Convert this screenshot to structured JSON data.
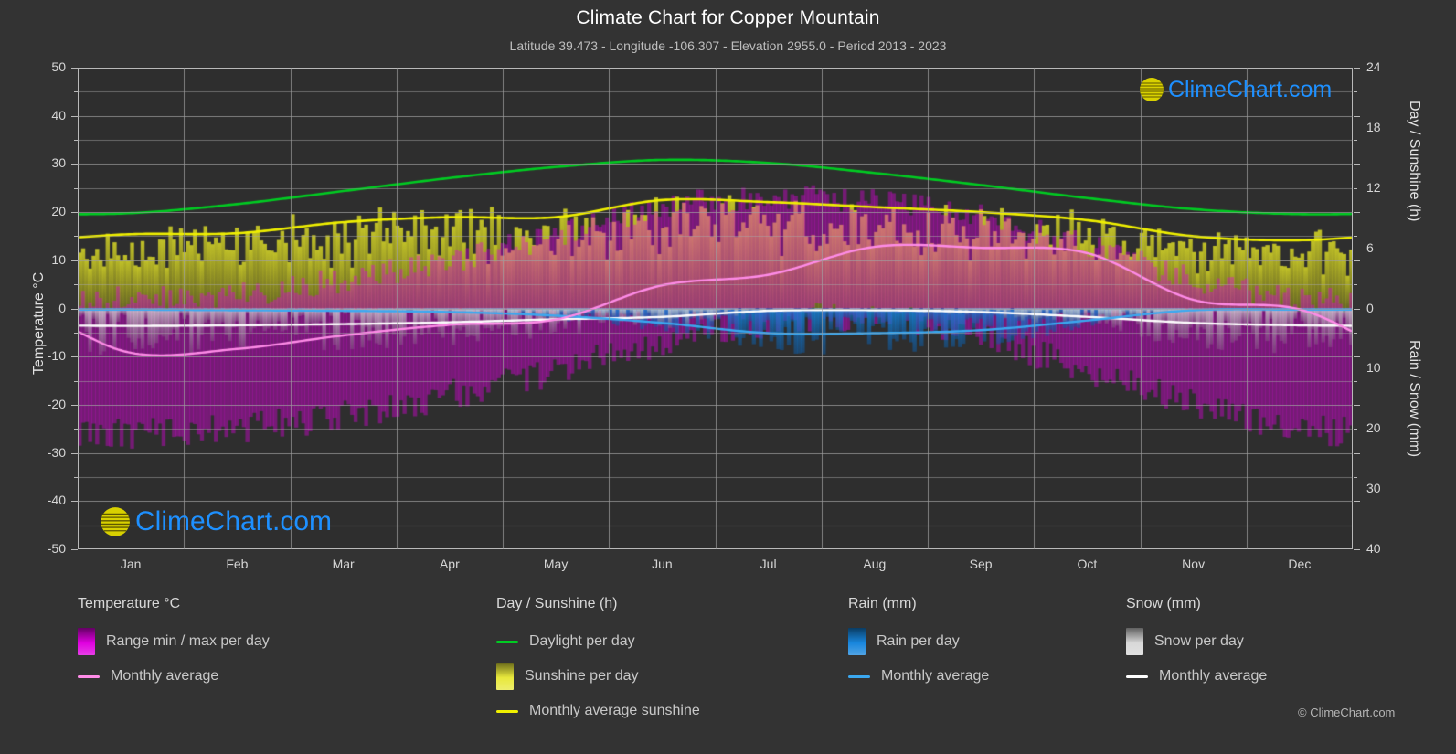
{
  "header": {
    "title": "Climate Chart for Copper Mountain",
    "subtitle": "Latitude 39.473 - Longitude -106.307 - Elevation 2955.0 - Period 2013 - 2023"
  },
  "branding": {
    "logo_text": "ClimeChart.com",
    "copyright": "© ClimeChart.com",
    "logo_crescent_color": "#cc33cc",
    "logo_sphere_color": "#d8d000",
    "logo_text_color": "#1e90ff"
  },
  "axes": {
    "left": {
      "label": "Temperature °C",
      "ticks": [
        "50",
        "40",
        "30",
        "20",
        "10",
        "0",
        "-10",
        "-20",
        "-30",
        "-40",
        "-50"
      ],
      "min": -50,
      "max": 50,
      "step": 10
    },
    "right_top": {
      "label": "Day / Sunshine (h)",
      "ticks": [
        "24",
        "18",
        "12",
        "6",
        "0"
      ],
      "min": 0,
      "max": 24
    },
    "right_bottom": {
      "label": "Rain / Snow (mm)",
      "ticks": [
        "0",
        "10",
        "20",
        "30",
        "40"
      ],
      "min": 0,
      "max": 40
    },
    "x": {
      "label": "",
      "ticks": [
        "Jan",
        "Feb",
        "Mar",
        "Apr",
        "May",
        "Jun",
        "Jul",
        "Aug",
        "Sep",
        "Oct",
        "Nov",
        "Dec"
      ]
    }
  },
  "legend": {
    "temperature": {
      "heading": "Temperature °C",
      "items": [
        {
          "label": "Range min / max per day",
          "marker": "swatch",
          "color": "#e000e0"
        },
        {
          "label": "Monthly average",
          "marker": "line",
          "color": "#ff8ce8"
        }
      ]
    },
    "sunshine": {
      "heading": "Day / Sunshine (h)",
      "items": [
        {
          "label": "Daylight per day",
          "marker": "line",
          "color": "#00cc22"
        },
        {
          "label": "Sunshine per day",
          "marker": "swatch",
          "color": "#e8e83c"
        },
        {
          "label": "Monthly average sunshine",
          "marker": "line",
          "color": "#f0f000"
        }
      ]
    },
    "rain": {
      "heading": "Rain (mm)",
      "items": [
        {
          "label": "Rain per day",
          "marker": "swatch",
          "color": "#1886dd"
        },
        {
          "label": "Monthly average",
          "marker": "line",
          "color": "#3ba8f0"
        }
      ]
    },
    "snow": {
      "heading": "Snow (mm)",
      "items": [
        {
          "label": "Snow per day",
          "marker": "swatch",
          "color": "#d8d8d8"
        },
        {
          "label": "Monthly average",
          "marker": "line",
          "color": "#ffffff"
        }
      ]
    }
  },
  "chart_data": {
    "type": "area",
    "title": "Climate Chart for Copper Mountain",
    "subtitle": "Latitude 39.473 - Longitude -106.307 - Elevation 2955.0 - Period 2013 - 2023",
    "xlabel": "",
    "ylabel": "Temperature °C",
    "ylabel_right_top": "Day / Sunshine (h)",
    "ylabel_right_bottom": "Rain / Snow (mm)",
    "ylim": [
      -50,
      50
    ],
    "ylim_right_top": [
      0,
      24
    ],
    "ylim_right_bottom": [
      0,
      40
    ],
    "grid": true,
    "legend_position": "below",
    "categories": [
      "Jan",
      "Feb",
      "Mar",
      "Apr",
      "May",
      "Jun",
      "Jul",
      "Aug",
      "Sep",
      "Oct",
      "Nov",
      "Dec"
    ],
    "series": [
      {
        "name": "Daylight per day",
        "unit": "h",
        "axis": "right_top",
        "color": "#00cc22",
        "values": [
          9.5,
          10.4,
          11.7,
          13.0,
          14.1,
          14.8,
          14.5,
          13.5,
          12.3,
          11.0,
          9.9,
          9.4
        ]
      },
      {
        "name": "Monthly average sunshine",
        "unit": "h",
        "axis": "right_top",
        "color": "#f0f000",
        "values": [
          7.4,
          7.5,
          8.6,
          9.1,
          9.1,
          10.8,
          10.6,
          10.1,
          9.6,
          8.8,
          7.2,
          6.8
        ]
      },
      {
        "name": "Temperature monthly average",
        "unit": "°C",
        "axis": "left",
        "color": "#ff8ce8",
        "values": [
          -9.2,
          -8.4,
          -5.6,
          -3.4,
          -2.3,
          4.8,
          7.0,
          12.8,
          12.6,
          11.5,
          1.8,
          -0.2
        ]
      },
      {
        "name": "Rain monthly average",
        "unit": "mm",
        "axis": "right_bottom",
        "color": "#3ba8f0",
        "values": [
          0.2,
          0.3,
          0.4,
          0.6,
          1.2,
          2.4,
          4.1,
          4.1,
          3.6,
          2.0,
          0.3,
          0.2
        ]
      },
      {
        "name": "Snow monthly average",
        "unit": "mm",
        "axis": "right_bottom",
        "color": "#ffffff",
        "values": [
          2.9,
          2.8,
          2.6,
          2.3,
          1.8,
          1.4,
          0.4,
          0.3,
          0.6,
          1.4,
          2.4,
          2.8
        ]
      }
    ],
    "daily_ranges": {
      "name": "Range min / max per day",
      "unit": "°C",
      "axis": "left",
      "color": "#e000e0",
      "monthly_min": [
        -26,
        -25,
        -22,
        -18,
        -13,
        -7,
        -3,
        -2,
        -6,
        -13,
        -20,
        -25
      ],
      "monthly_max": [
        2,
        3,
        6,
        10,
        15,
        21,
        23,
        22,
        19,
        13,
        6,
        2
      ]
    }
  }
}
